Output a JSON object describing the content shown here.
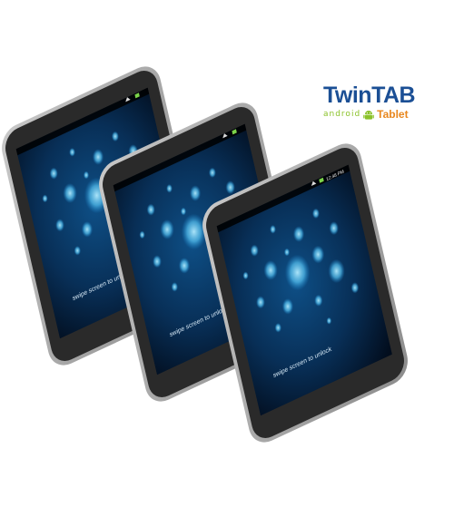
{
  "brand": {
    "title": "TwinTAB",
    "android_word": "ANDROID",
    "tablet_word": "Tablet",
    "colors": {
      "title": "#1b4f95",
      "android": "#8bc22a",
      "tablet": "#e8871e"
    }
  },
  "tablets": [
    {
      "unlock_text": "swipe screen to unlock"
    },
    {
      "unlock_text": "swipe screen to unlock"
    },
    {
      "unlock_text": "swipe screen to unlock",
      "clock_text": "12:48 PM"
    }
  ],
  "icons": [
    "android-robot-icon",
    "wifi-icon",
    "battery-icon"
  ]
}
